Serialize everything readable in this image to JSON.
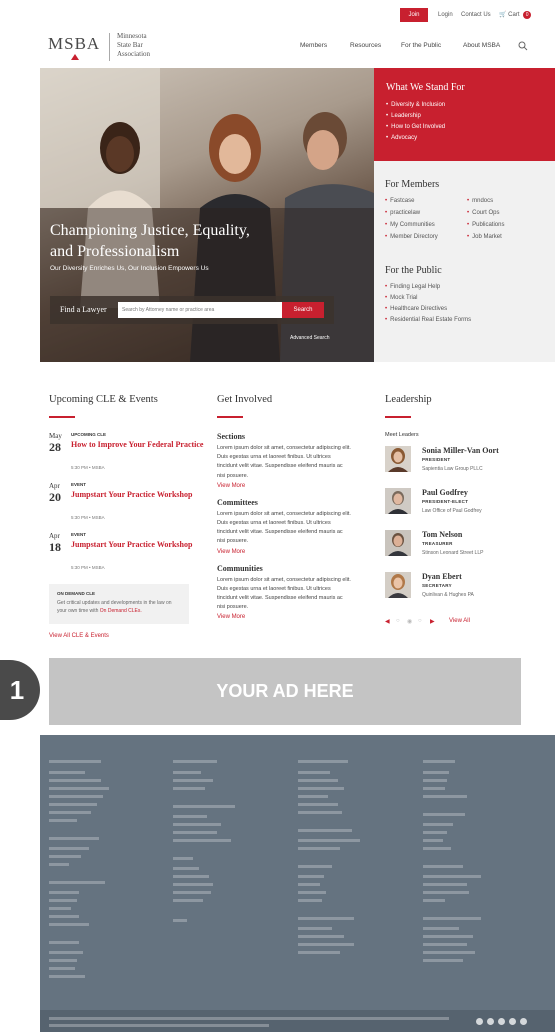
{
  "utility_bar": {
    "join": "Join",
    "login": "Login",
    "contact": "Contact Us",
    "cart": "Cart",
    "cart_count": "0"
  },
  "header": {
    "logo": "MSBA",
    "logo_line1": "Minnesota",
    "logo_line2": "State Bar",
    "logo_line3": "Association",
    "nav": [
      "Members",
      "Resources",
      "For the Public",
      "About MSBA"
    ]
  },
  "hero": {
    "title_line1": "Championing Justice, Equality,",
    "title_line2": "and Professionalism",
    "subtitle": "Our Diversity Enriches Us, Our Inclusion Empowers Us",
    "find_label": "Find a Lawyer",
    "find_placeholder": "Search by Attorney name or practice area",
    "search_button": "Search",
    "advanced": "Advanced Search"
  },
  "sidebar": {
    "stand_title": "What We Stand For",
    "stand_items": [
      "Diversity & Inclusion",
      "Leadership",
      "How to Get Involved",
      "Advocacy"
    ],
    "members_title": "For Members",
    "members_items": [
      "Fastcase",
      "mndocs",
      "practicelaw",
      "Court Ops",
      "My Communities",
      "Publications",
      "Member Directory",
      "Job Market"
    ],
    "public_title": "For the Public",
    "public_items": [
      "Finding Legal Help",
      "Mock Trial",
      "Healthcare Directives",
      "Residential Real Estate Forms"
    ]
  },
  "events": {
    "title": "Upcoming CLE & Events",
    "items": [
      {
        "month": "May",
        "day": "28",
        "tag": "UPCOMING CLE",
        "title": "How to Improve Your Federal Practice",
        "time": "5:30 PM • MSBA"
      },
      {
        "month": "Apr",
        "day": "20",
        "tag": "EVENT",
        "title": "Jumpstart Your Practice Workshop",
        "time": "5:30 PM • MSBA"
      },
      {
        "month": "Apr",
        "day": "18",
        "tag": "EVENT",
        "title": "Jumpstart Your Practice Workshop",
        "time": "5:30 PM • MSBA"
      }
    ],
    "ondemand_title": "ON DEMAND CLE",
    "ondemand_text": "Get critical updates and developments in the law on your own time with",
    "ondemand_link": "On Demand CLEs.",
    "view_all": "View All CLE & Events"
  },
  "involved": {
    "title": "Get Involved",
    "items": [
      {
        "heading": "Sections",
        "body": "Lorem ipsum dolor sit amet, consectetur adipiscing elit. Duis egestas urna et laoreet finibus. Ut ultrices tincidunt velit vitae. Suspendisse eleifend mauris ac nisi posuere.",
        "more": "View More"
      },
      {
        "heading": "Committees",
        "body": "Lorem ipsum dolor sit amet, consectetur adipiscing elit. Duis egestas urna et laoreet finibus. Ut ultrices tincidunt velit vitae. Suspendisse eleifend mauris ac nisi posuere.",
        "more": "View More"
      },
      {
        "heading": "Communities",
        "body": "Lorem ipsum dolor sit amet, consectetur adipiscing elit. Duis egestas urna et laoreet finibus. Ut ultrices tincidunt velit vitae. Suspendisse eleifend mauris ac nisi posuere.",
        "more": "View More"
      }
    ]
  },
  "leadership": {
    "title": "Leadership",
    "meet": "Meet Leaders",
    "leaders": [
      {
        "name": "Sonia Miller-Van Oort",
        "role": "PRESIDENT",
        "org": "Sapientia Law Group PLLC"
      },
      {
        "name": "Paul Godfrey",
        "role": "PRESIDENT-ELECT",
        "org": "Law Office of Paul Godfrey"
      },
      {
        "name": "Tom Nelson",
        "role": "TREASURER",
        "org": "Stinson Leonard Street LLP"
      },
      {
        "name": "Dyan Ebert",
        "role": "SECRETARY",
        "org": "Quinlivan & Hughes PA"
      }
    ],
    "view_all": "View All"
  },
  "ad": {
    "number": "1",
    "text": "YOUR AD HERE"
  },
  "colors": {
    "brand_red": "#c8202f",
    "footer": "#657380"
  }
}
